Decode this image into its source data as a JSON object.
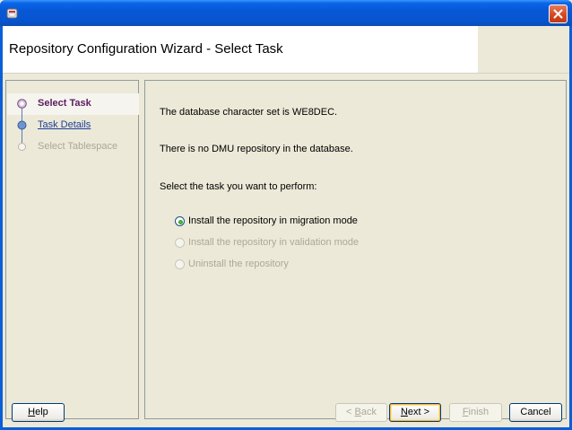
{
  "window": {
    "icon": "oracle-app-icon",
    "close_icon": "close-icon"
  },
  "header": {
    "title": "Repository Configuration Wizard - Select Task"
  },
  "train": {
    "steps": [
      {
        "label": "Select Task",
        "state": "current"
      },
      {
        "label": "Task Details",
        "state": "link"
      },
      {
        "label": "Select Tablespace",
        "state": "disabled"
      }
    ]
  },
  "content": {
    "charset_text": "The database character set is WE8DEC.",
    "repo_text": "There is no DMU repository in the database.",
    "prompt_text": "Select the task you want to perform:",
    "options": [
      {
        "label": "Install the repository in migration mode",
        "selected": true,
        "enabled": true
      },
      {
        "label": "Install the repository in validation mode",
        "selected": false,
        "enabled": false
      },
      {
        "label": "Uninstall the repository",
        "selected": false,
        "enabled": false
      }
    ]
  },
  "buttons": {
    "help": {
      "mnemonic": "H",
      "rest": "elp"
    },
    "back": {
      "prefix": "< ",
      "mnemonic": "B",
      "rest": "ack"
    },
    "next": {
      "mnemonic": "N",
      "rest": "ext >"
    },
    "finish": {
      "mnemonic": "F",
      "rest": "inish"
    },
    "cancel": {
      "label": "Cancel"
    }
  },
  "colors": {
    "titlebar": "#0858d6",
    "accent_current_step": "#5b1d60",
    "link": "#1c3d99"
  }
}
